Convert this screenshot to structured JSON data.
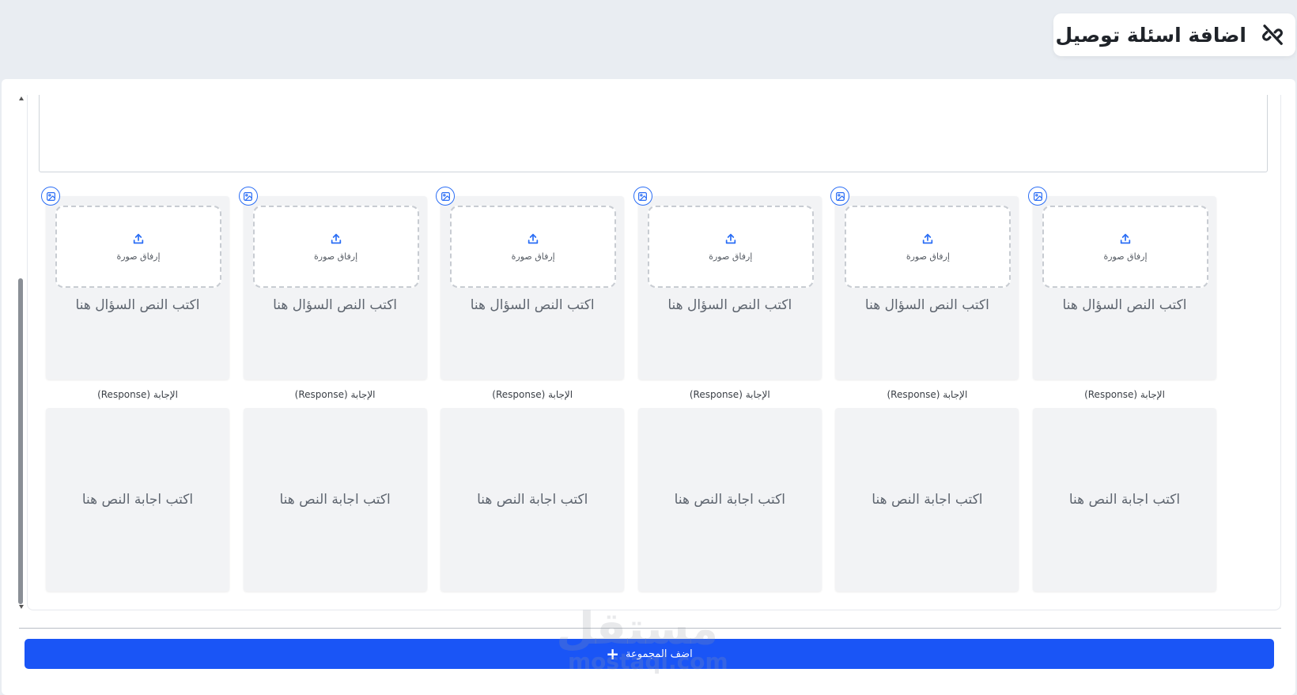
{
  "header": {
    "title": "اضافة اسئلة توصيل",
    "icon": "unlink-icon"
  },
  "upload_label": "إرفاق صورة",
  "response_label": "(Response) الإجابة",
  "pairs": [
    {
      "question_placeholder": "اكتب النص السؤال هنا",
      "answer_placeholder": "اكتب اجابة النص هنا"
    },
    {
      "question_placeholder": "اكتب النص السؤال هنا",
      "answer_placeholder": "اكتب اجابة النص هنا"
    },
    {
      "question_placeholder": "اكتب النص السؤال هنا",
      "answer_placeholder": "اكتب اجابة النص هنا"
    },
    {
      "question_placeholder": "اكتب النص السؤال هنا",
      "answer_placeholder": "اكتب اجابة النص هنا"
    },
    {
      "question_placeholder": "اكتب النص السؤال هنا",
      "answer_placeholder": "اكتب اجابة النص هنا"
    },
    {
      "question_placeholder": "اكتب النص السؤال هنا",
      "answer_placeholder": "اكتب اجابة النص هنا"
    }
  ],
  "footer": {
    "add_group_label": "اضف المجموعة",
    "add_icon": "plus-icon"
  },
  "watermark": {
    "line1": "مستقل",
    "line2": "mostaql.com"
  },
  "colors": {
    "accent": "#1a55f6",
    "icon_blue": "#2b6ef5",
    "card_bg": "#f2f3f5",
    "page_bg": "#e9edf2"
  }
}
